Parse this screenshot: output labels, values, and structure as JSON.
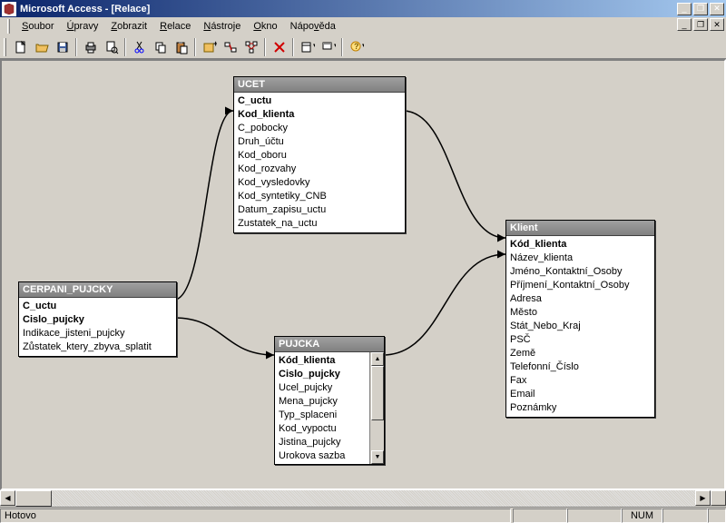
{
  "app": {
    "title": "Microsoft Access - [Relace]"
  },
  "menu": {
    "items": [
      "Soubor",
      "Úpravy",
      "Zobrazit",
      "Relace",
      "Nástroje",
      "Okno",
      "Nápověda"
    ],
    "underlines": [
      "S",
      "Ú",
      "Z",
      "R",
      "N",
      "O",
      "N"
    ]
  },
  "status": {
    "ready": "Hotovo",
    "num": "NUM"
  },
  "tables": {
    "ucet": {
      "title": "UCET",
      "fields": [
        {
          "name": "C_uctu",
          "pk": true
        },
        {
          "name": "Kod_klienta",
          "pk": true
        },
        {
          "name": "C_pobocky",
          "pk": false
        },
        {
          "name": "Druh_účtu",
          "pk": false
        },
        {
          "name": "Kod_oboru",
          "pk": false
        },
        {
          "name": "Kod_rozvahy",
          "pk": false
        },
        {
          "name": "Kod_vysledovky",
          "pk": false
        },
        {
          "name": "Kod_syntetiky_CNB",
          "pk": false
        },
        {
          "name": "Datum_zapisu_uctu",
          "pk": false
        },
        {
          "name": "Zustatek_na_uctu",
          "pk": false
        }
      ]
    },
    "cerpani": {
      "title": "CERPANI_PUJCKY",
      "fields": [
        {
          "name": "C_uctu",
          "pk": true
        },
        {
          "name": "Cislo_pujcky",
          "pk": true
        },
        {
          "name": "Indikace_jisteni_pujcky",
          "pk": false
        },
        {
          "name": "Zůstatek_ktery_zbyva_splatit",
          "pk": false
        }
      ]
    },
    "pujcka": {
      "title": "PUJCKA",
      "fields": [
        {
          "name": "Kód_klienta",
          "pk": true
        },
        {
          "name": "Cislo_pujcky",
          "pk": true
        },
        {
          "name": "Ucel_pujcky",
          "pk": false
        },
        {
          "name": "Mena_pujcky",
          "pk": false
        },
        {
          "name": "Typ_splaceni",
          "pk": false
        },
        {
          "name": "Kod_vypoctu",
          "pk": false
        },
        {
          "name": "Jistina_pujcky",
          "pk": false
        },
        {
          "name": "Urokova sazba",
          "pk": false
        }
      ]
    },
    "klient": {
      "title": "Klient",
      "fields": [
        {
          "name": "Kód_klienta",
          "pk": true
        },
        {
          "name": "Název_klienta",
          "pk": false
        },
        {
          "name": "Jméno_Kontaktní_Osoby",
          "pk": false
        },
        {
          "name": "Příjmení_Kontaktní_Osoby",
          "pk": false
        },
        {
          "name": "Adresa",
          "pk": false
        },
        {
          "name": "Město",
          "pk": false
        },
        {
          "name": "Stát_Nebo_Kraj",
          "pk": false
        },
        {
          "name": "PSČ",
          "pk": false
        },
        {
          "name": "Země",
          "pk": false
        },
        {
          "name": "Telefonní_Číslo",
          "pk": false
        },
        {
          "name": "Fax",
          "pk": false
        },
        {
          "name": "Email",
          "pk": false
        },
        {
          "name": "Poznámky",
          "pk": false
        }
      ]
    }
  }
}
